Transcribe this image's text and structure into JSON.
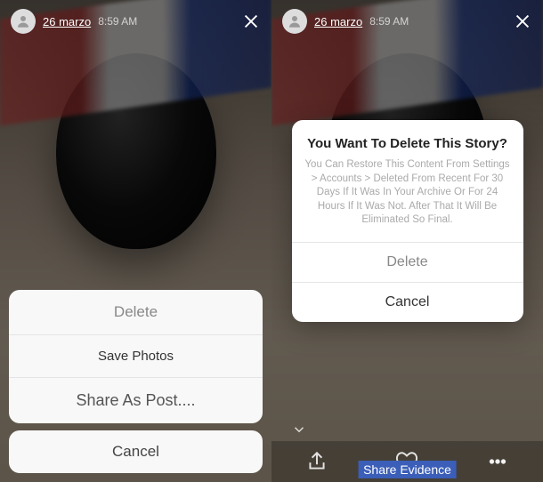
{
  "left": {
    "header": {
      "date": "26 marzo",
      "time": "8:59 AM"
    },
    "sheet": {
      "delete": "Delete",
      "save": "Save Photos",
      "share": "Share As Post....",
      "cancel": "Cancel"
    }
  },
  "right": {
    "header": {
      "date": "26 marzo",
      "time": "8:59 AM"
    },
    "dialog": {
      "title": "You Want To Delete This Story?",
      "body": "You Can Restore This Content From Settings > Accounts > Deleted From Recent For 30 Days If It Was In Your Archive Or For 24 Hours If It Was Not. After That It Will Be Eliminated So Final.",
      "delete": "Delete",
      "cancel": "Cancel"
    },
    "bottom": {
      "label": "Share Evidence"
    }
  }
}
